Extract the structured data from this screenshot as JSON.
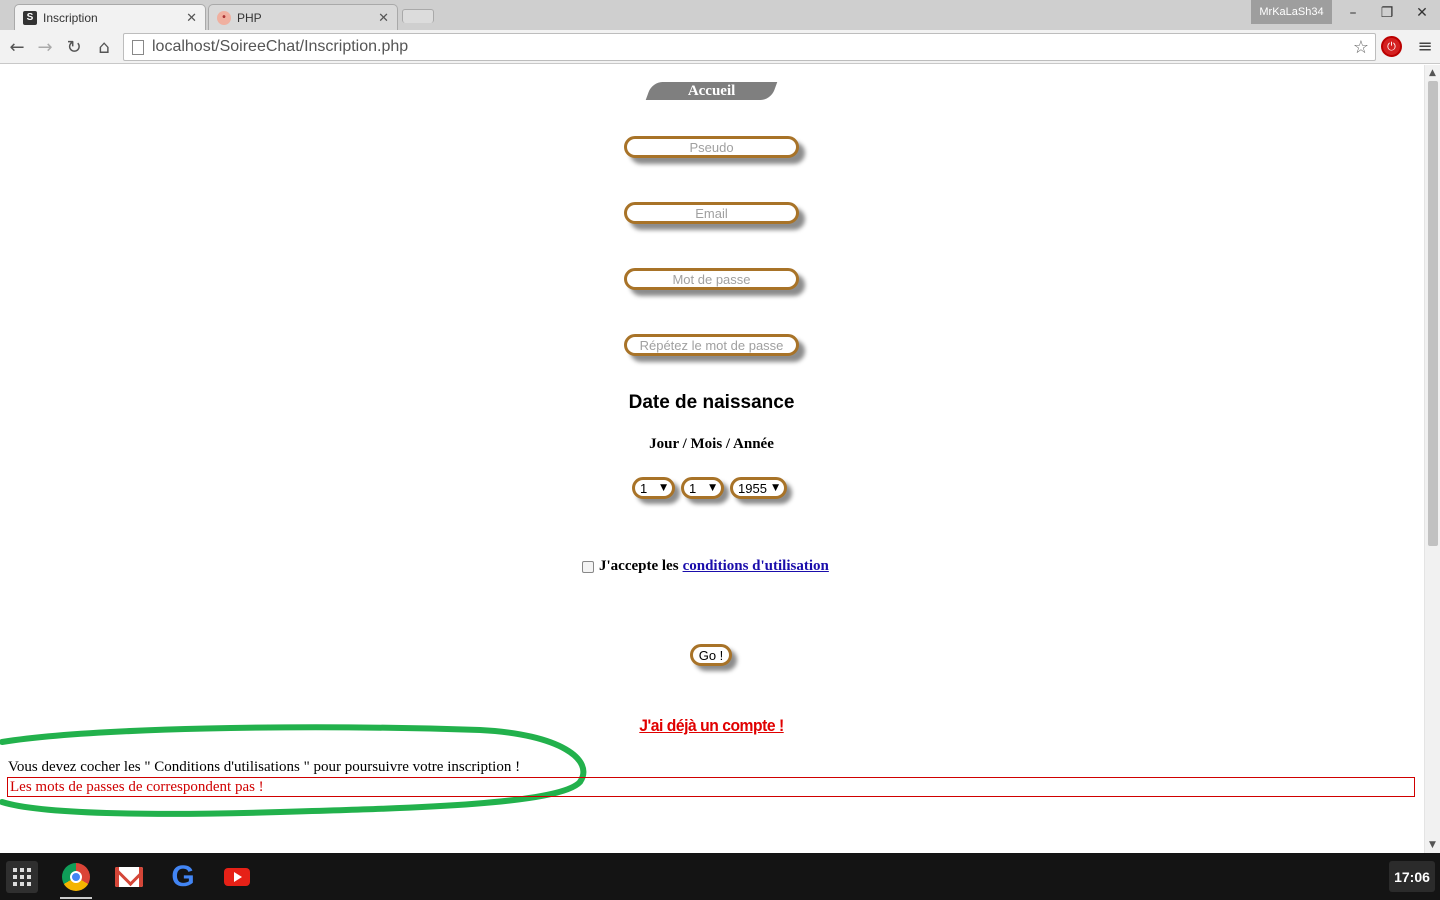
{
  "browser": {
    "tabs": [
      {
        "title": "Inscription",
        "favicon": "S"
      },
      {
        "title": "PHP",
        "favicon": "php"
      }
    ],
    "profile_name": "MrKaLaSh34",
    "url": "localhost/SoireeChat/Inscription.php"
  },
  "page": {
    "nav_home": "Accueil",
    "fields": {
      "pseudo_placeholder": "Pseudo",
      "email_placeholder": "Email",
      "password_placeholder": "Mot de passe",
      "password_repeat_placeholder": "Répétez le mot de passe"
    },
    "birthdate": {
      "title": "Date de naissance",
      "subtitle": "Jour / Mois / Année",
      "day": "1",
      "month": "1",
      "year": "1955"
    },
    "accept": {
      "text": "J'accepte les",
      "link": "conditions d'utilisation",
      "checked": false
    },
    "submit_label": "Go !",
    "has_account_link": "J'ai déjà un compte !",
    "errors": {
      "terms": "Vous devez cocher les \" Conditions d'utilisations \" pour poursuivre votre inscription !",
      "password_mismatch": "Les mots de passes de correspondent pas !"
    },
    "colors": {
      "field_border": "#a87328",
      "error_red": "#d00000",
      "annotation_green": "#22b14c",
      "link_blue": "#1a0dab"
    }
  },
  "shelf": {
    "apps": [
      "chrome-icon",
      "gmail-icon",
      "google-icon",
      "youtube-icon"
    ],
    "time": "17:06"
  }
}
